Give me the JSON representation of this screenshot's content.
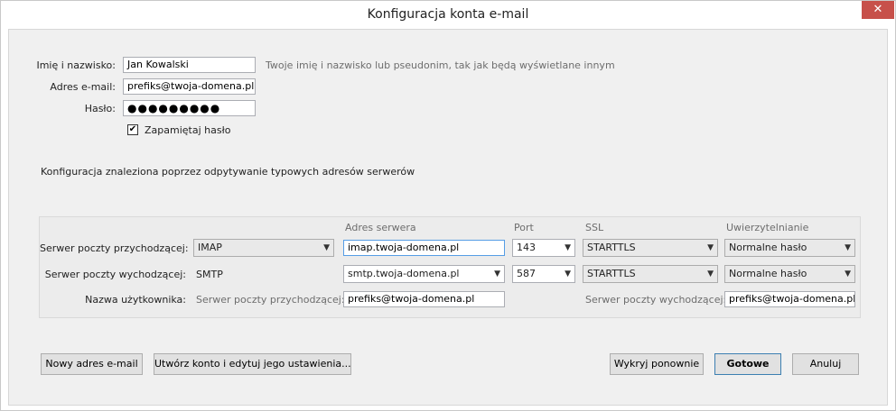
{
  "window": {
    "title": "Konfiguracja konta e-mail",
    "close_glyph": "✕"
  },
  "identity": {
    "name_label": "Imię i nazwisko:",
    "name_value": "Jan Kowalski",
    "name_hint": "Twoje imię i nazwisko lub pseudonim, tak jak będą wyświetlane innym",
    "email_label": "Adres e-mail:",
    "email_value": "prefiks@twoja-domena.pl",
    "password_label": "Hasło:",
    "password_value": "●●●●●●●●●",
    "remember_label": "Zapamiętaj hasło",
    "remember_checked": true
  },
  "status_text": "Konfiguracja znaleziona poprzez odpytywanie typowych adresów serwerów",
  "servers": {
    "headers": {
      "address": "Adres serwera",
      "port": "Port",
      "ssl": "SSL",
      "auth": "Uwierzytelnianie"
    },
    "incoming": {
      "label": "Serwer poczty przychodzącej:",
      "protocol": "IMAP",
      "address": "imap.twoja-domena.pl",
      "port": "143",
      "ssl": "STARTTLS",
      "auth": "Normalne hasło"
    },
    "outgoing": {
      "label": "Serwer poczty wychodzącej:",
      "protocol": "SMTP",
      "address": "smtp.twoja-domena.pl",
      "port": "587",
      "ssl": "STARTTLS",
      "auth": "Normalne hasło"
    },
    "username": {
      "label": "Nazwa użytkownika:",
      "incoming_label": "Serwer poczty przychodzącej:",
      "incoming_value": "prefiks@twoja-domena.pl",
      "outgoing_label": "Serwer poczty wychodzącej:",
      "outgoing_value": "prefiks@twoja-domena.pl"
    }
  },
  "buttons": {
    "new_address": "Nowy adres e-mail",
    "create_and_edit": "Utwórz konto i edytuj jego ustawienia...",
    "redetect": "Wykryj ponownie",
    "done": "Gotowe",
    "cancel": "Anuluj"
  },
  "icons": {
    "dropdown": "chevron-down-icon",
    "check": "checkmark-icon"
  }
}
